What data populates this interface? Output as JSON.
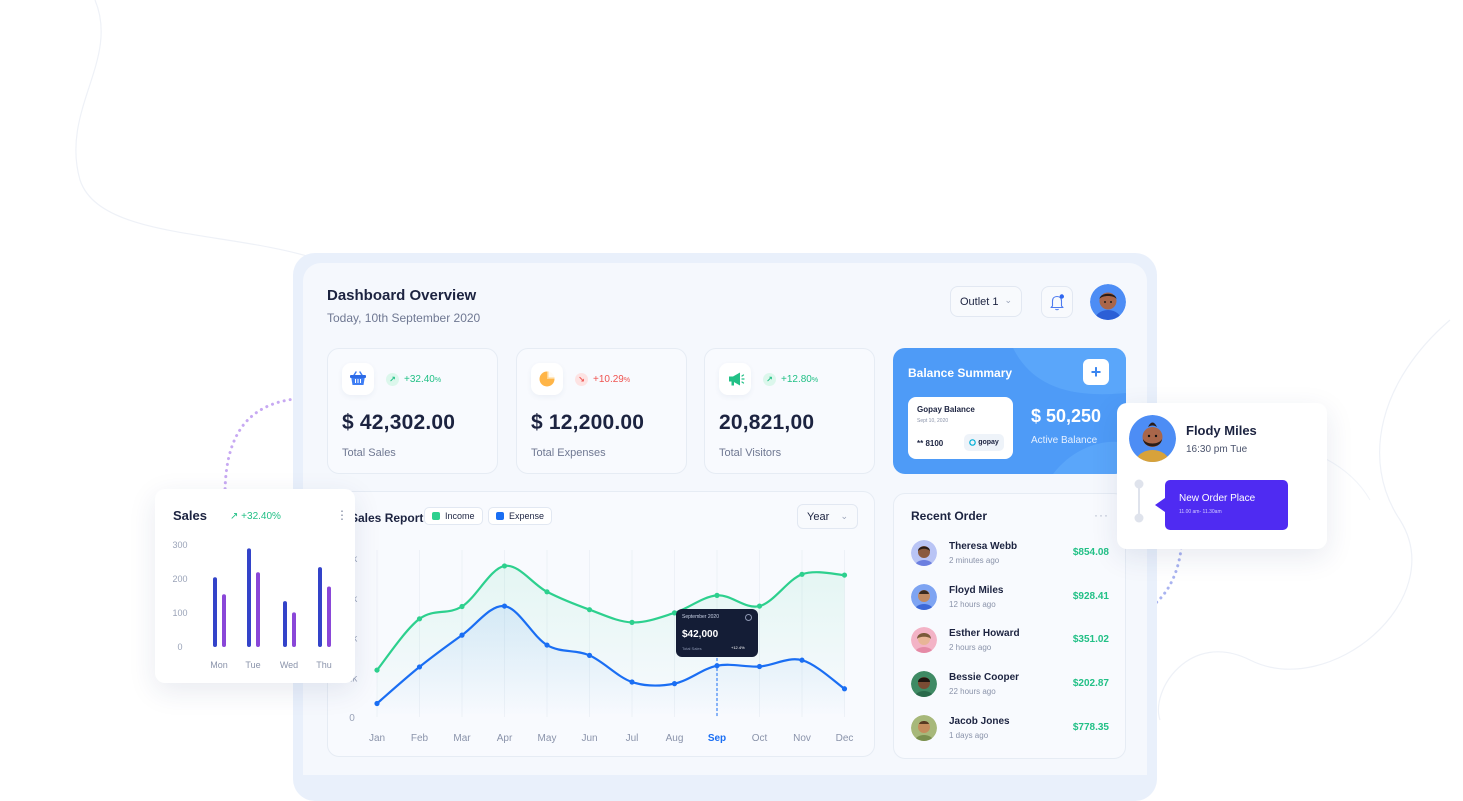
{
  "header": {
    "title": "Dashboard Overview",
    "date": "Today, 10th September 2020",
    "outlet": "Outlet 1"
  },
  "stats": [
    {
      "value": "$ 42,302.00",
      "label": "Total Sales",
      "change": "+32.40",
      "change_unit": "%",
      "direction": "up",
      "icon": "basket-icon"
    },
    {
      "value": "$ 12,200.00",
      "label": "Total Expenses",
      "change": "+10.29",
      "change_unit": "%",
      "direction": "down",
      "icon": "pie-chart-icon"
    },
    {
      "value": "20,821,00",
      "label": "Total Visitors",
      "change": "+12.80",
      "change_unit": "%",
      "direction": "up",
      "icon": "megaphone-icon"
    }
  ],
  "balance": {
    "title": "Balance Summary",
    "card_name": "Gopay Balance",
    "card_date": "Sept 10, 2020",
    "card_number": "** 8100",
    "card_brand": "gopay",
    "amount": "$ 50,250",
    "amount_label": "Active Balance"
  },
  "sales_report": {
    "title": "Sales Report",
    "legend_income": "Income",
    "legend_expense": "Expense",
    "period": "Year",
    "tooltip": {
      "title": "September 2020",
      "value": "$42,000",
      "label": "Total Sales",
      "change": "+12.4%"
    }
  },
  "recent_orders": {
    "title": "Recent Order",
    "items": [
      {
        "name": "Theresa Webb",
        "time": "2 minutes ago",
        "amount": "$854.08"
      },
      {
        "name": "Floyd Miles",
        "time": "12 hours ago",
        "amount": "$928.41"
      },
      {
        "name": "Esther Howard",
        "time": "2 hours ago",
        "amount": "$351.02"
      },
      {
        "name": "Bessie Cooper",
        "time": "22 hours ago",
        "amount": "$202.87"
      },
      {
        "name": "Jacob Jones",
        "time": "1 days ago",
        "amount": "$778.35"
      }
    ]
  },
  "sales_widget": {
    "title": "Sales",
    "change": "+32.40%"
  },
  "flody": {
    "name": "Flody Miles",
    "time": "16:30 pm Tue",
    "notice_title": "New Order Place",
    "notice_time": "11.00 am- 11.30am"
  },
  "colors": {
    "income": "#2dd08e",
    "expense": "#1a6ef3",
    "accent": "#4f2bf2",
    "balance_bg": "#4e9bf7",
    "positive": "#22c086",
    "negative": "#ef5350"
  },
  "chart_data": [
    {
      "type": "line",
      "title": "Sales Report",
      "categories": [
        "Jan",
        "Feb",
        "Mar",
        "Apr",
        "May",
        "Jun",
        "Jul",
        "Aug",
        "Sep",
        "Oct",
        "Nov",
        "Dec"
      ],
      "highlight": "Sep",
      "y_ticks": [
        "0",
        "1k",
        "2k",
        "3k",
        "4k"
      ],
      "ylim": [
        0,
        4
      ],
      "series": [
        {
          "name": "Income",
          "points": [
            [
              1,
              1.18
            ],
            [
              2,
              2.47
            ],
            [
              3,
              2.78
            ],
            [
              4,
              3.8
            ],
            [
              5,
              3.15
            ],
            [
              6,
              2.7
            ],
            [
              7,
              2.38
            ],
            [
              8,
              2.62
            ],
            [
              9,
              3.06
            ],
            [
              10,
              2.79
            ],
            [
              11,
              3.59
            ],
            [
              12,
              3.57
            ]
          ]
        },
        {
          "name": "Expense",
          "points": [
            [
              1,
              0.34
            ],
            [
              2,
              1.26
            ],
            [
              3,
              2.06
            ],
            [
              4,
              2.79
            ],
            [
              5,
              1.81
            ],
            [
              6,
              1.55
            ],
            [
              7,
              0.88
            ],
            [
              8,
              0.84
            ],
            [
              9,
              1.29
            ],
            [
              10,
              1.27
            ],
            [
              11,
              1.43
            ],
            [
              12,
              0.71
            ]
          ]
        }
      ],
      "legend": "top"
    },
    {
      "type": "bar",
      "title": "Sales",
      "categories": [
        "Mon",
        "Tue",
        "Wed",
        "Thu"
      ],
      "y_ticks": [
        "0",
        "100",
        "200",
        "300"
      ],
      "ylim": [
        0,
        300
      ],
      "series": [
        {
          "values": [
            205,
            290,
            135,
            235
          ]
        },
        {
          "values": [
            155,
            220,
            102,
            178
          ]
        }
      ]
    }
  ]
}
